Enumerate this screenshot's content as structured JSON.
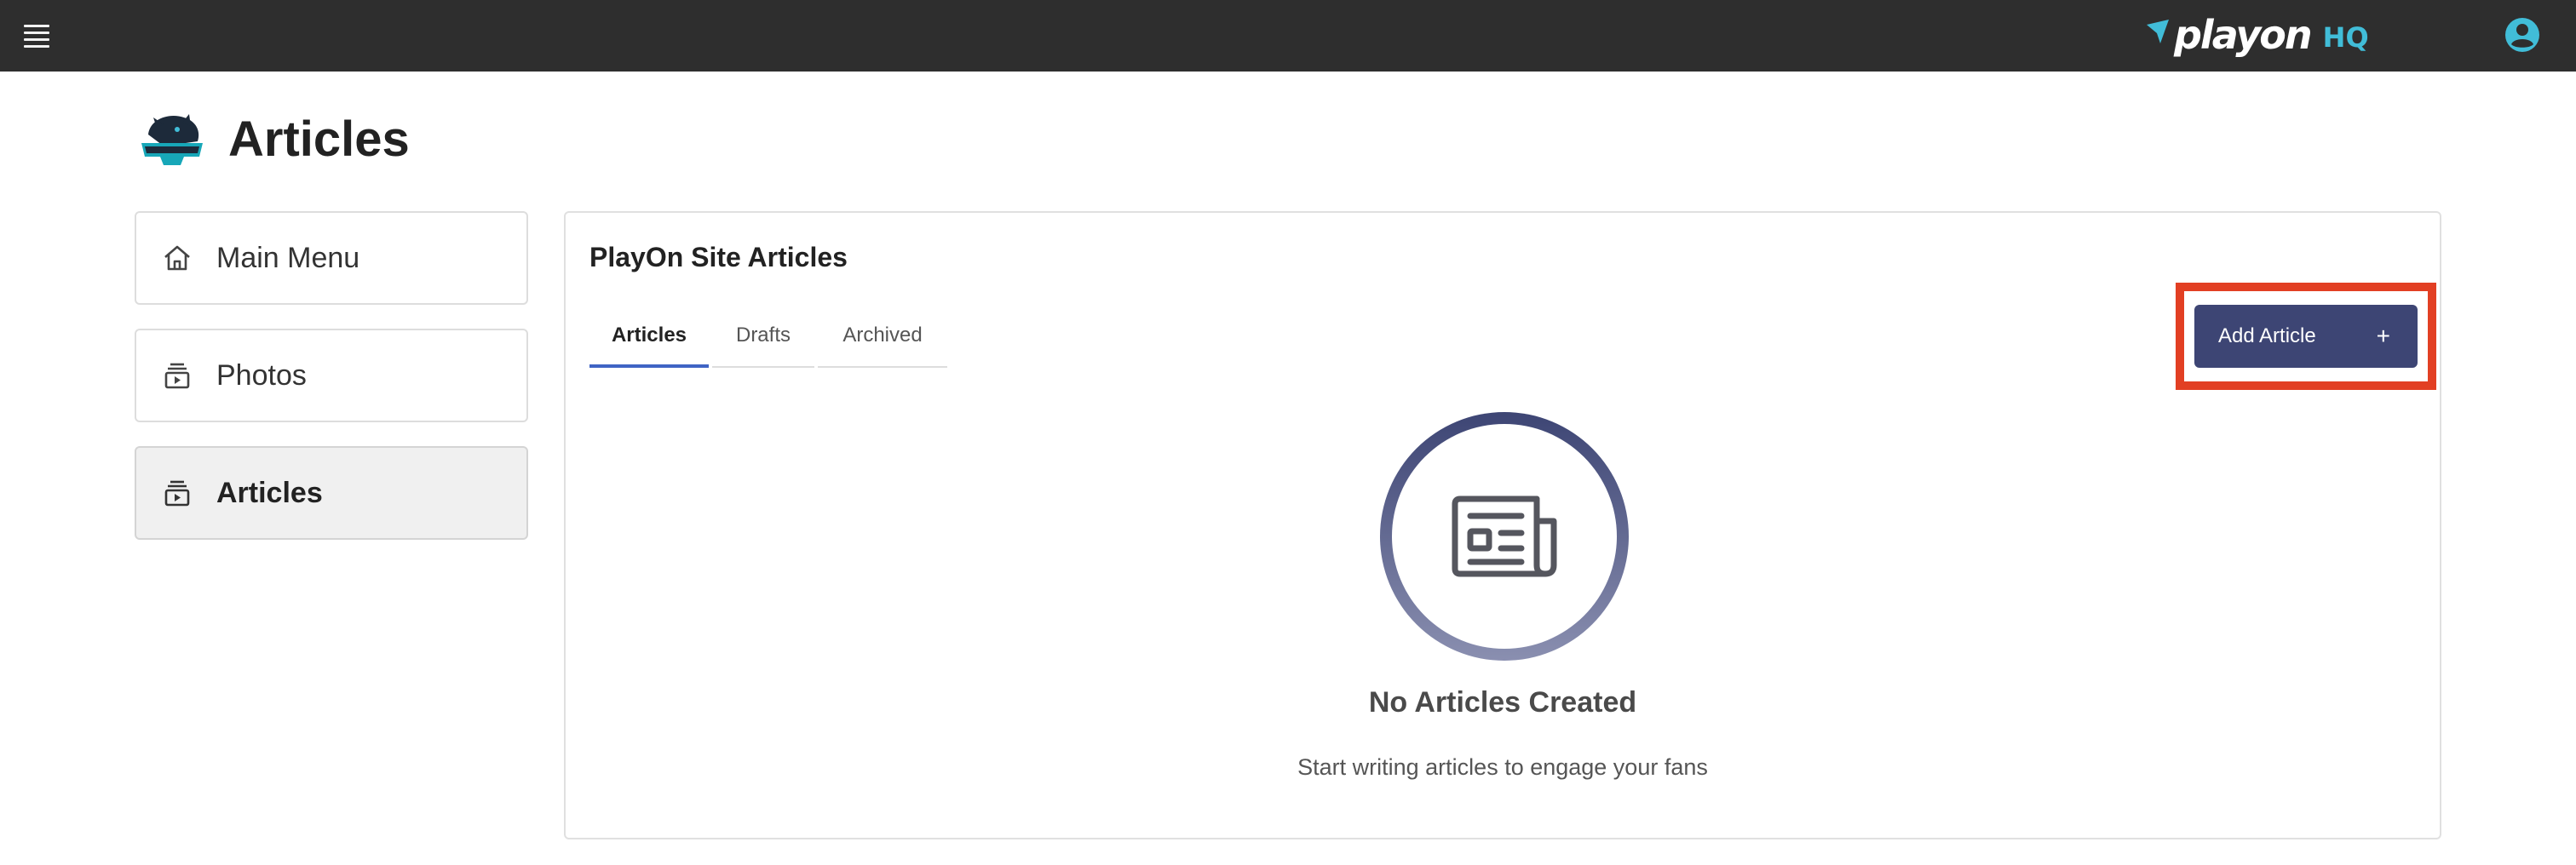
{
  "topbar": {
    "menu_icon": "hamburger-menu-icon",
    "logo_text": "playon",
    "logo_suffix": "HQ",
    "account_icon": "account-circle-icon",
    "colors": {
      "background": "#2e2e2e",
      "logo_accent": "#41bdd8"
    }
  },
  "header": {
    "team_logo": "panthers-team-logo",
    "title": "Articles"
  },
  "sidebar": {
    "items": [
      {
        "label": "Main Menu",
        "icon": "home-icon",
        "active": false
      },
      {
        "label": "Photos",
        "icon": "media-collection-icon",
        "active": false
      },
      {
        "label": "Articles",
        "icon": "media-collection-icon",
        "active": true
      }
    ]
  },
  "main": {
    "title": "PlayOn Site Articles",
    "tabs": [
      {
        "label": "Articles",
        "active": true
      },
      {
        "label": "Drafts",
        "active": false
      },
      {
        "label": "Archived",
        "active": false
      }
    ],
    "add_button": {
      "label": "Add Article",
      "icon": "plus-icon"
    },
    "empty_state": {
      "icon": "newspaper-icon",
      "title": "No Articles Created",
      "subtitle": "Start writing articles to engage your fans"
    },
    "colors": {
      "primary": "#3d4574",
      "tab_indicator": "#3f64c4",
      "highlight": "#e23f23"
    }
  }
}
